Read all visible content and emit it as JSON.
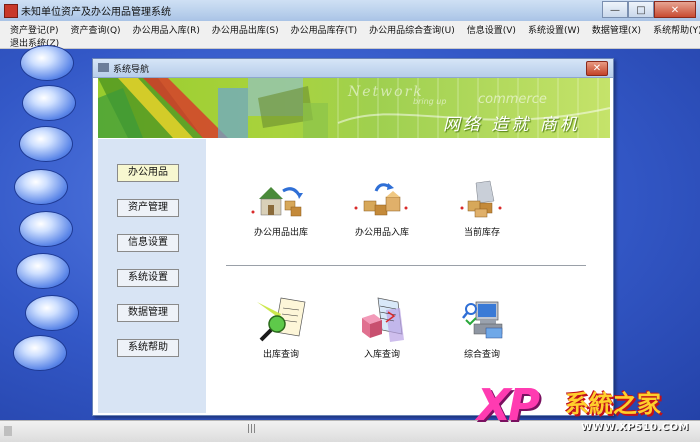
{
  "window": {
    "title": "未知单位资产及办公用品管理系统",
    "controls": [
      "—",
      "□",
      "✕"
    ]
  },
  "menu": {
    "row1": [
      "资产登记(P)",
      "资产查询(Q)",
      "办公用品入库(R)",
      "办公用品出库(S)",
      "办公用品库存(T)",
      "办公用品综合查询(U)",
      "信息设置(V)",
      "系统设置(W)",
      "数据管理(X)",
      "系统帮助(Y)"
    ],
    "row2": [
      "退出系统(Z)"
    ]
  },
  "child": {
    "title": "系统导航",
    "close": "✕"
  },
  "banner": {
    "network": "Network",
    "bring": "bring up",
    "commerce": "commerce",
    "slogan": "网络 造就 商机"
  },
  "nav": [
    "办公用品",
    "资产管理",
    "信息设置",
    "系统设置",
    "数据管理",
    "系统帮助"
  ],
  "tiles": {
    "top": [
      {
        "label": "办公用品出库",
        "icon": "house-boxes-out-icon"
      },
      {
        "label": "办公用品入库",
        "icon": "boxes-arrow-in-icon"
      },
      {
        "label": "当前库存",
        "icon": "inventory-boxes-icon"
      }
    ],
    "bottom": [
      {
        "label": "出库查询",
        "icon": "magnifier-document-icon"
      },
      {
        "label": "入库查询",
        "icon": "cube-document-icon"
      },
      {
        "label": "综合查询",
        "icon": "computer-search-icon"
      }
    ]
  },
  "statusbar": {
    "grip": "|||"
  },
  "watermark": {
    "xp": "XP",
    "name": "系統之家",
    "url": "WWW.XP510.COM"
  }
}
